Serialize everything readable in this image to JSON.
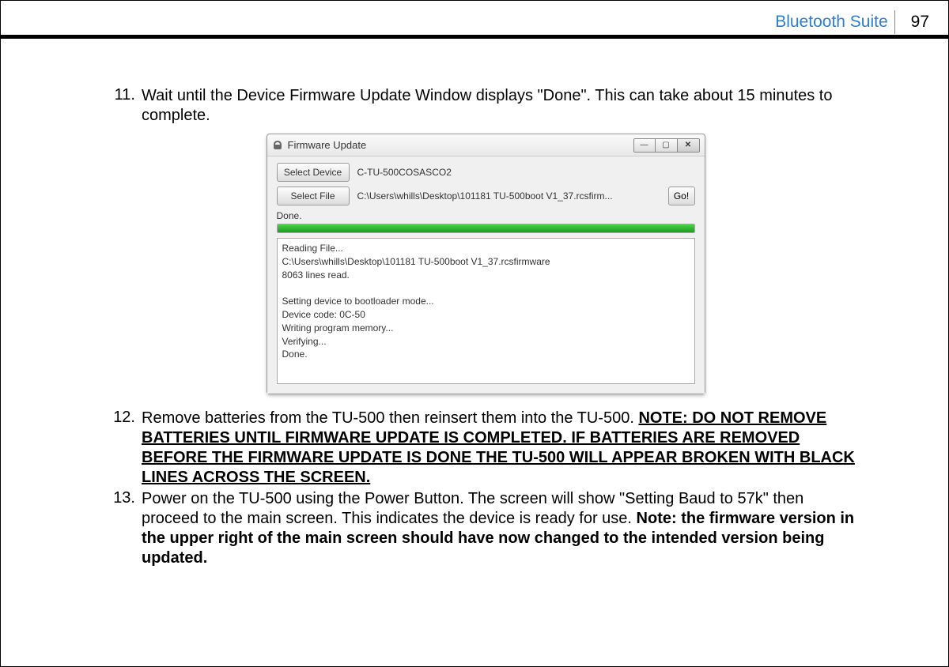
{
  "header": {
    "title": "Bluetooth Suite",
    "page_number": "97"
  },
  "steps": {
    "s11": {
      "num": "11.",
      "text": "Wait until the Device Firmware Update Window displays \"Done\". This can take about 15 minutes to complete."
    },
    "s12": {
      "num": "12.",
      "pre": "Remove batteries from the TU-500 then reinsert them into the TU-500. ",
      "note": "NOTE: DO NOT REMOVE BATTERIES UNTIL FIRMWARE UPDATE IS COMPLETED. IF BATTERIES ARE REMOVED BEFORE THE FIRMWARE UPDATE IS DONE THE TU-500 WILL APPEAR BROKEN WITH BLACK LINES ACROSS THE SCREEN."
    },
    "s13": {
      "num": "13.",
      "pre": "Power on the TU-500 using the Power Button. The screen will show \"Setting Baud to 57k\" then proceed to the main screen. This indicates the device is ready for use. ",
      "note": "Note: the firmware version in the upper right of the main screen should have now changed to the intended version being updated."
    }
  },
  "firmware_window": {
    "title": "Firmware Update",
    "select_device_label": "Select Device",
    "device_value": "C-TU-500COSASCO2",
    "select_file_label": "Select File",
    "file_value": "C:\\Users\\whills\\Desktop\\101181 TU-500boot V1_37.rcsfirm...",
    "go_label": "Go!",
    "status": "Done.",
    "log": "Reading File...\nC:\\Users\\whills\\Desktop\\101181 TU-500boot V1_37.rcsfirmware\n8063 lines read.\n\nSetting device to bootloader mode...\nDevice code: 0C-50\nWriting program memory...\nVerifying...\nDone.",
    "winbtns": {
      "min": "—",
      "max": "▢",
      "close": "✕"
    }
  }
}
